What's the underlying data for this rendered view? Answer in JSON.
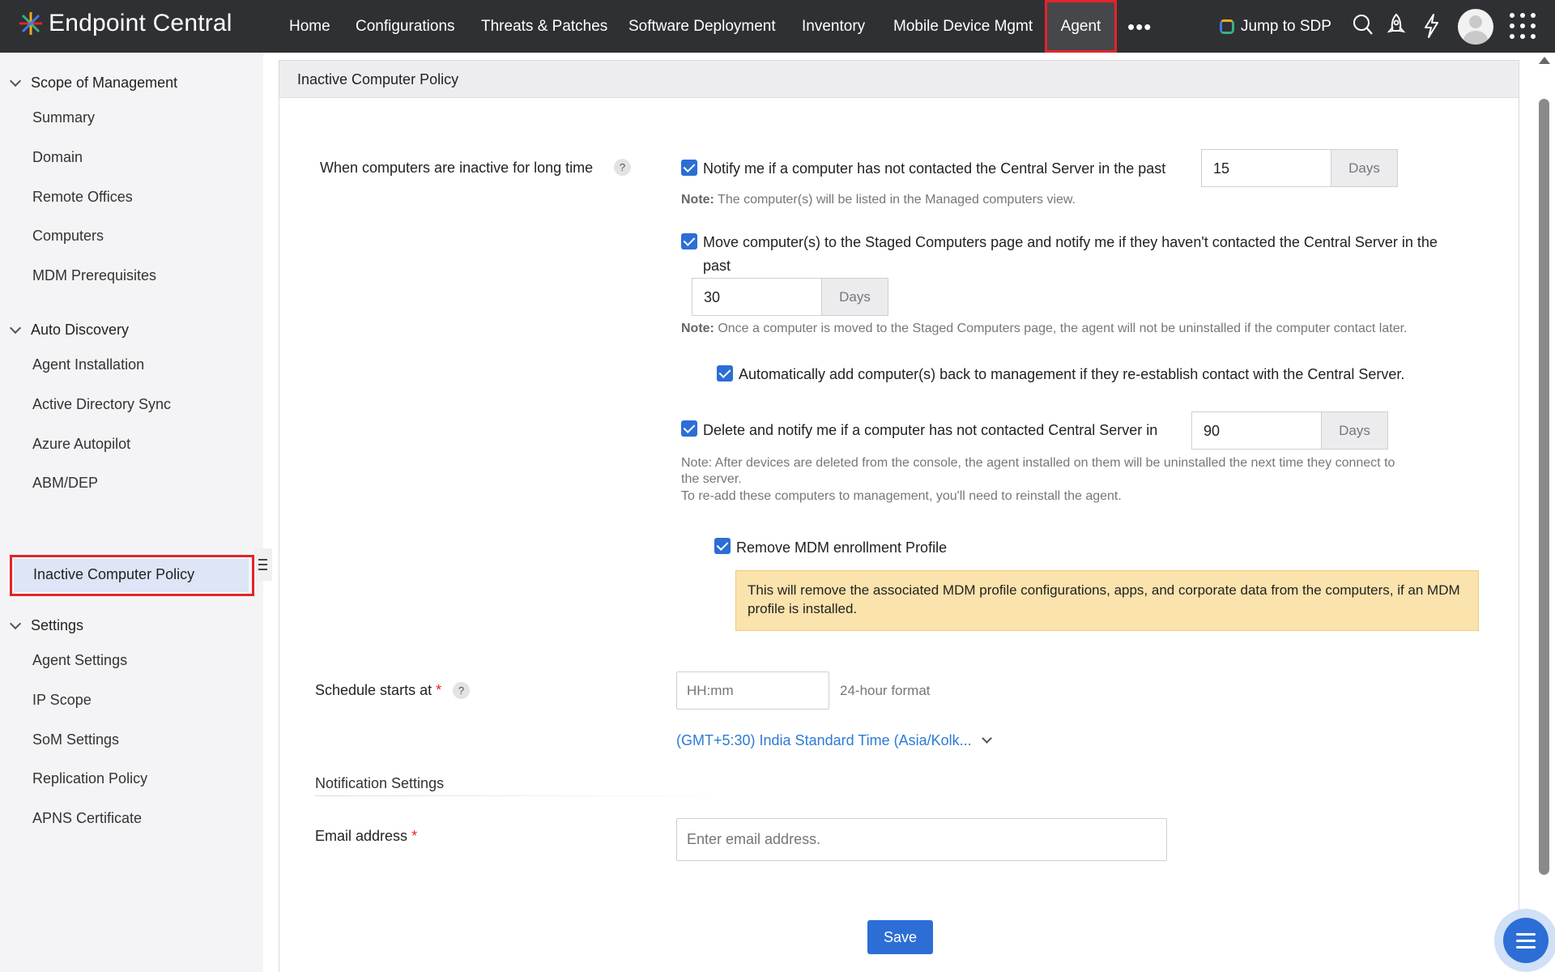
{
  "app": {
    "title": "Endpoint Central"
  },
  "nav": {
    "items": [
      "Home",
      "Configurations",
      "Threats & Patches",
      "Software Deployment",
      "Inventory",
      "Mobile Device Mgmt",
      "Agent"
    ],
    "active": "Agent",
    "more": "•••",
    "jump_label": "Jump to SDP"
  },
  "sidebar": {
    "sections": [
      {
        "title": "Scope of Management",
        "items": [
          "Summary",
          "Domain",
          "Remote Offices",
          "Computers",
          "MDM Prerequisites"
        ]
      },
      {
        "title": "Auto Discovery",
        "items": [
          "Agent Installation",
          "Active Directory Sync",
          "Azure Autopilot",
          "ABM/DEP",
          "Inactive Computer Policy"
        ]
      },
      {
        "title": "Settings",
        "items": [
          "Agent Settings",
          "IP Scope",
          "SoM Settings",
          "Replication Policy",
          "APNS Certificate"
        ]
      }
    ],
    "active_item": "Inactive Computer Policy"
  },
  "panel": {
    "title": "Inactive Computer Policy",
    "inactive_label": "When computers are inactive for long time",
    "help": "?",
    "notify": {
      "checked": true,
      "label": "Notify me if a computer has not contacted the Central Server in the past",
      "days": "15",
      "unit": "Days",
      "note_prefix": "Note:",
      "note": " The computer(s) will be listed in the Managed computers view."
    },
    "move": {
      "checked": true,
      "label_line1": "Move computer(s) to the Staged Computers page and notify me if they haven't contacted the Central Server in the",
      "label_line2": "past",
      "days": "30",
      "unit": "Days",
      "note_prefix": "Note:",
      "note": " Once a computer is moved to the Staged Computers page, the agent will not be uninstalled if the computer contact later."
    },
    "auto_add": {
      "checked": true,
      "label": "Automatically add computer(s) back to management if they re-establish contact with the Central Server."
    },
    "delete": {
      "checked": true,
      "label": "Delete and notify me if a computer has not contacted Central Server in",
      "days": "90",
      "unit": "Days",
      "note_line1": "Note: After devices are deleted from the console, the agent installed on them will be uninstalled the next time they connect to",
      "note_line2": "the server.",
      "note_line3": "To re-add these computers to management, you'll need to reinstall the agent."
    },
    "remove_mdm": {
      "checked": true,
      "label": "Remove MDM enrollment Profile",
      "warning": "This will remove the associated MDM profile configurations, apps, and corporate data from the computers, if an MDM profile is installed."
    },
    "schedule": {
      "label": "Schedule starts at",
      "required": "*",
      "placeholder": "HH:mm",
      "hint": "24-hour format",
      "timezone": "(GMT+5:30) India Standard Time (Asia/Kolk..."
    },
    "notification": {
      "heading": "Notification Settings",
      "email_label": "Email address",
      "required": "*",
      "email_placeholder": "Enter email address."
    },
    "save_label": "Save"
  },
  "colors": {
    "accent": "#2c6ed5",
    "highlight": "#e3242b",
    "topbar": "#2f3033",
    "warning_bg": "#fbe3ad"
  },
  "icons": [
    "logo-icon",
    "search-icon",
    "rocket-icon",
    "lightning-icon",
    "apps-grid-icon",
    "menu-icon"
  ]
}
